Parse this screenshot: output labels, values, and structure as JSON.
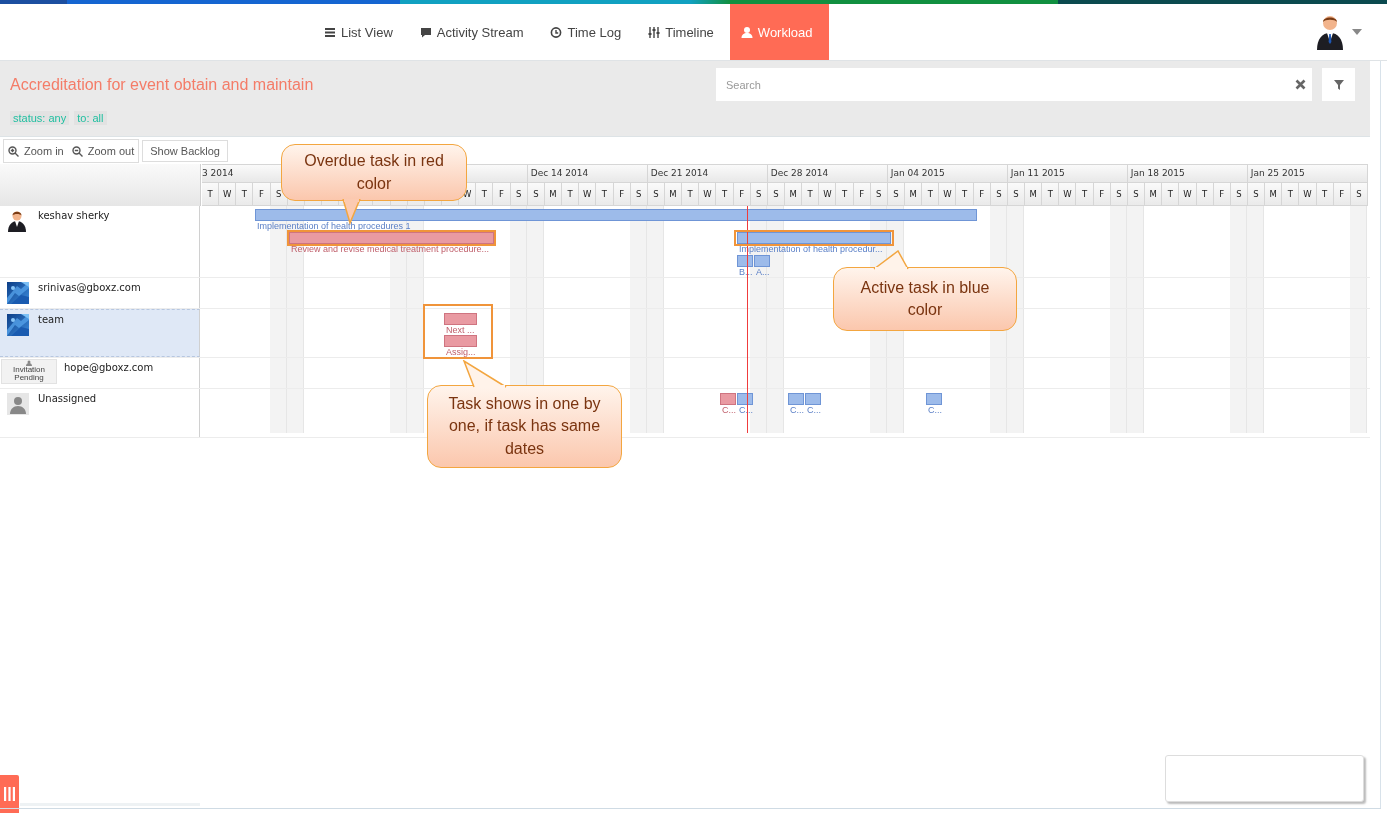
{
  "nav": {
    "tabs": [
      {
        "label": "List View",
        "selected": false
      },
      {
        "label": "Activity Stream",
        "selected": false
      },
      {
        "label": "Time Log",
        "selected": false
      },
      {
        "label": "Timeline",
        "selected": false
      },
      {
        "label": "Workload",
        "selected": true
      }
    ]
  },
  "project": {
    "title": "Accreditation for event obtain and maintain",
    "search": {
      "placeholder": "Search"
    },
    "filters": [
      "status: any",
      "to: all"
    ]
  },
  "toolbar": {
    "buttons": [
      {
        "label": "Zoom in"
      },
      {
        "label": "Zoom out"
      },
      {
        "label": "Show Backlog"
      }
    ]
  },
  "timeline": {
    "weeks": [
      {
        "kind": "cut",
        "label": "3 2014",
        "days": [
          "T",
          "W",
          "T",
          "F",
          "S"
        ]
      },
      {
        "kind": "covered"
      },
      {
        "kind": "covered_start",
        "days": [
          "W",
          "T",
          "F",
          "S"
        ]
      },
      {
        "kind": "full",
        "label": "Dec 14 2014",
        "days": [
          "S",
          "M",
          "T",
          "W",
          "T",
          "F",
          "S"
        ]
      },
      {
        "kind": "full",
        "label": "Dec 21 2014",
        "days": [
          "S",
          "M",
          "T",
          "W",
          "T",
          "F",
          "S"
        ]
      },
      {
        "kind": "full",
        "label": "Dec 28 2014",
        "days": [
          "S",
          "M",
          "T",
          "W",
          "T",
          "F",
          "S"
        ]
      },
      {
        "kind": "full",
        "label": "Jan 04 2015",
        "days": [
          "S",
          "M",
          "T",
          "W",
          "T",
          "F",
          "S"
        ]
      },
      {
        "kind": "full",
        "label": "Jan 11 2015",
        "days": [
          "S",
          "M",
          "T",
          "W",
          "T",
          "F",
          "S"
        ]
      },
      {
        "kind": "full",
        "label": "Jan 18 2015",
        "days": [
          "S",
          "M",
          "T",
          "W",
          "T",
          "F",
          "S"
        ]
      },
      {
        "kind": "full",
        "label": "Jan 25 2015",
        "days": [
          "S",
          "M",
          "T",
          "W",
          "T",
          "F",
          "S"
        ]
      }
    ]
  },
  "resources": [
    {
      "name": "keshav sherky",
      "kind": "person",
      "selected": false,
      "tasks": [
        {
          "label": "Implementation of health procedures 1",
          "kind": "active"
        },
        {
          "label": "Review and revise medical treatment procedure...",
          "kind": "overdue"
        },
        {
          "label": "Implementation of health procedur...",
          "kind": "active"
        },
        {
          "label": "B...",
          "kind": "active"
        },
        {
          "label": "A...",
          "kind": "active"
        }
      ]
    },
    {
      "name": "srinivas@gboxz.com",
      "selected": false
    },
    {
      "name": "team",
      "selected": true,
      "tasks": [
        {
          "label": "Next ...",
          "kind": "overdue"
        },
        {
          "label": "Assig...",
          "kind": "overdue"
        }
      ]
    },
    {
      "name": "hope@gboxz.com",
      "kind": "pending",
      "avatar_text": "Invitation Pending",
      "selected": false
    },
    {
      "name": "Unassigned",
      "kind": "blank",
      "selected": false,
      "tasks": [
        {
          "label": "C...",
          "kind": "overdue"
        },
        {
          "label": "C...",
          "kind": "active"
        },
        {
          "label": "C...",
          "kind": "active"
        },
        {
          "label": "C...",
          "kind": "active"
        },
        {
          "label": "C...",
          "kind": "active"
        }
      ]
    }
  ],
  "callouts": [
    {
      "text": "Overdue task in red color"
    },
    {
      "text": "Active task in blue color"
    },
    {
      "text": "Task shows in one by one, if task has same dates"
    }
  ]
}
